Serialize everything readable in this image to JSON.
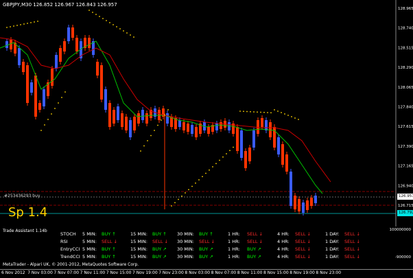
{
  "chart": {
    "title": "GBPJPY,M30  126.852 126.967 126.843 126.957",
    "order_label": "#253436293 buy",
    "sp_text": "Sp 1.4",
    "bid_price": "126.957",
    "ask_price": "126.792",
    "price_labels": [
      "128.965",
      "128.740",
      "128.515",
      "128.290",
      "128.065",
      "127.840",
      "127.615",
      "127.390",
      "127.165",
      "126.940",
      "126.715"
    ],
    "colors": {
      "bull": "#3a5cff",
      "bear": "#ff3300",
      "ma_fast": "#00c000",
      "ma_slow": "#cc0000",
      "sar": "#ffd400",
      "grid": "#222"
    }
  },
  "indicator": {
    "title": "Trade Assistant 1.14b",
    "scale_top": "100000000",
    "scale_bottom": "-900000",
    "rows": [
      {
        "name": "STOCH",
        "s5": "BUY",
        "s15": "BUY",
        "s30": "BUY",
        "s1h": "SELL",
        "s4h": "SELL",
        "s1d": "SELL"
      },
      {
        "name": "RSI",
        "s5": "SELL",
        "s15": "SELL",
        "s30": "SELL",
        "s1h": "SELL",
        "s4h": "SELL",
        "s1d": "SELL"
      },
      {
        "name": "EntryCCI",
        "s5": "BUY",
        "s15": "BUY",
        "s30": "BUY",
        "s1h": "BUY",
        "s4h": "SELL",
        "s1d": "SELL"
      },
      {
        "name": "TrendCCI",
        "s5": "BUY",
        "s15": "BUY",
        "s30": "BUY",
        "s1h": "BUY",
        "s4h": "SELL",
        "s1d": "SELL"
      }
    ],
    "tf_labels": {
      "m5": "5 MIN:",
      "m15": "15 MIN:",
      "m30": "30 MIN:",
      "h1": "1 HR:",
      "h4": "4 HR:",
      "d1": "1 DAY:"
    },
    "arrows": {
      "up": "↑",
      "down": "↓",
      "up_right": "↗"
    }
  },
  "copyright": "MetaTrader - Alpari UK, © 2001-2012, MetaQuotes Software Corp.",
  "time_labels": [
    "6 Nov 2012",
    "7 Nov 03:00",
    "7 Nov 07:00",
    "7 Nov 11:00",
    "7 Nov 15:00",
    "7 Nov 19:00",
    "7 Nov 23:00",
    "8 Nov 03:00",
    "8 Nov 07:00",
    "8 Nov 11:00",
    "8 Nov 15:00",
    "8 Nov 19:00",
    "8 Nov 23:00"
  ]
}
